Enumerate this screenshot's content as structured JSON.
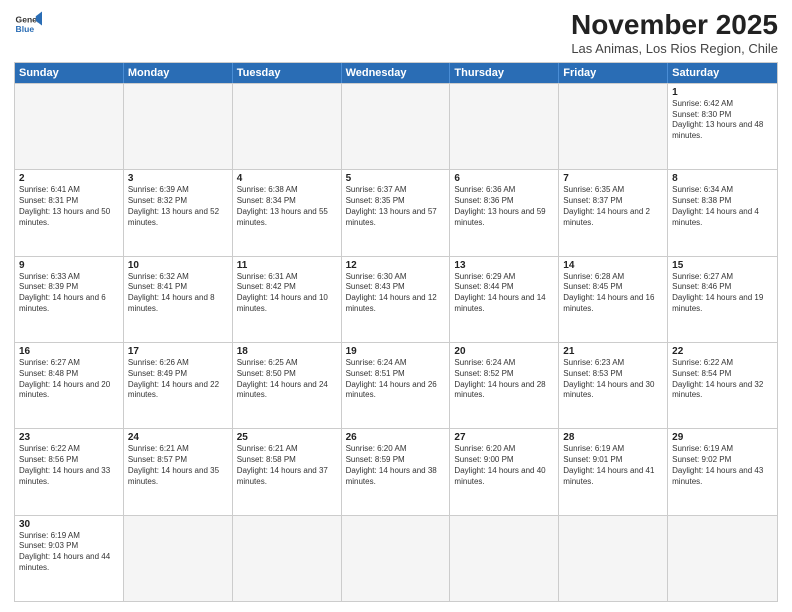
{
  "header": {
    "logo_general": "General",
    "logo_blue": "Blue",
    "month_title": "November 2025",
    "location": "Las Animas, Los Rios Region, Chile"
  },
  "days_of_week": [
    "Sunday",
    "Monday",
    "Tuesday",
    "Wednesday",
    "Thursday",
    "Friday",
    "Saturday"
  ],
  "weeks": [
    [
      {
        "day": "",
        "text": ""
      },
      {
        "day": "",
        "text": ""
      },
      {
        "day": "",
        "text": ""
      },
      {
        "day": "",
        "text": ""
      },
      {
        "day": "",
        "text": ""
      },
      {
        "day": "",
        "text": ""
      },
      {
        "day": "1",
        "text": "Sunrise: 6:42 AM\nSunset: 8:30 PM\nDaylight: 13 hours and 48 minutes."
      }
    ],
    [
      {
        "day": "2",
        "text": "Sunrise: 6:41 AM\nSunset: 8:31 PM\nDaylight: 13 hours and 50 minutes."
      },
      {
        "day": "3",
        "text": "Sunrise: 6:39 AM\nSunset: 8:32 PM\nDaylight: 13 hours and 52 minutes."
      },
      {
        "day": "4",
        "text": "Sunrise: 6:38 AM\nSunset: 8:34 PM\nDaylight: 13 hours and 55 minutes."
      },
      {
        "day": "5",
        "text": "Sunrise: 6:37 AM\nSunset: 8:35 PM\nDaylight: 13 hours and 57 minutes."
      },
      {
        "day": "6",
        "text": "Sunrise: 6:36 AM\nSunset: 8:36 PM\nDaylight: 13 hours and 59 minutes."
      },
      {
        "day": "7",
        "text": "Sunrise: 6:35 AM\nSunset: 8:37 PM\nDaylight: 14 hours and 2 minutes."
      },
      {
        "day": "8",
        "text": "Sunrise: 6:34 AM\nSunset: 8:38 PM\nDaylight: 14 hours and 4 minutes."
      }
    ],
    [
      {
        "day": "9",
        "text": "Sunrise: 6:33 AM\nSunset: 8:39 PM\nDaylight: 14 hours and 6 minutes."
      },
      {
        "day": "10",
        "text": "Sunrise: 6:32 AM\nSunset: 8:41 PM\nDaylight: 14 hours and 8 minutes."
      },
      {
        "day": "11",
        "text": "Sunrise: 6:31 AM\nSunset: 8:42 PM\nDaylight: 14 hours and 10 minutes."
      },
      {
        "day": "12",
        "text": "Sunrise: 6:30 AM\nSunset: 8:43 PM\nDaylight: 14 hours and 12 minutes."
      },
      {
        "day": "13",
        "text": "Sunrise: 6:29 AM\nSunset: 8:44 PM\nDaylight: 14 hours and 14 minutes."
      },
      {
        "day": "14",
        "text": "Sunrise: 6:28 AM\nSunset: 8:45 PM\nDaylight: 14 hours and 16 minutes."
      },
      {
        "day": "15",
        "text": "Sunrise: 6:27 AM\nSunset: 8:46 PM\nDaylight: 14 hours and 19 minutes."
      }
    ],
    [
      {
        "day": "16",
        "text": "Sunrise: 6:27 AM\nSunset: 8:48 PM\nDaylight: 14 hours and 20 minutes."
      },
      {
        "day": "17",
        "text": "Sunrise: 6:26 AM\nSunset: 8:49 PM\nDaylight: 14 hours and 22 minutes."
      },
      {
        "day": "18",
        "text": "Sunrise: 6:25 AM\nSunset: 8:50 PM\nDaylight: 14 hours and 24 minutes."
      },
      {
        "day": "19",
        "text": "Sunrise: 6:24 AM\nSunset: 8:51 PM\nDaylight: 14 hours and 26 minutes."
      },
      {
        "day": "20",
        "text": "Sunrise: 6:24 AM\nSunset: 8:52 PM\nDaylight: 14 hours and 28 minutes."
      },
      {
        "day": "21",
        "text": "Sunrise: 6:23 AM\nSunset: 8:53 PM\nDaylight: 14 hours and 30 minutes."
      },
      {
        "day": "22",
        "text": "Sunrise: 6:22 AM\nSunset: 8:54 PM\nDaylight: 14 hours and 32 minutes."
      }
    ],
    [
      {
        "day": "23",
        "text": "Sunrise: 6:22 AM\nSunset: 8:56 PM\nDaylight: 14 hours and 33 minutes."
      },
      {
        "day": "24",
        "text": "Sunrise: 6:21 AM\nSunset: 8:57 PM\nDaylight: 14 hours and 35 minutes."
      },
      {
        "day": "25",
        "text": "Sunrise: 6:21 AM\nSunset: 8:58 PM\nDaylight: 14 hours and 37 minutes."
      },
      {
        "day": "26",
        "text": "Sunrise: 6:20 AM\nSunset: 8:59 PM\nDaylight: 14 hours and 38 minutes."
      },
      {
        "day": "27",
        "text": "Sunrise: 6:20 AM\nSunset: 9:00 PM\nDaylight: 14 hours and 40 minutes."
      },
      {
        "day": "28",
        "text": "Sunrise: 6:19 AM\nSunset: 9:01 PM\nDaylight: 14 hours and 41 minutes."
      },
      {
        "day": "29",
        "text": "Sunrise: 6:19 AM\nSunset: 9:02 PM\nDaylight: 14 hours and 43 minutes."
      }
    ],
    [
      {
        "day": "30",
        "text": "Sunrise: 6:19 AM\nSunset: 9:03 PM\nDaylight: 14 hours and 44 minutes."
      },
      {
        "day": "",
        "text": ""
      },
      {
        "day": "",
        "text": ""
      },
      {
        "day": "",
        "text": ""
      },
      {
        "day": "",
        "text": ""
      },
      {
        "day": "",
        "text": ""
      },
      {
        "day": "",
        "text": ""
      }
    ]
  ]
}
